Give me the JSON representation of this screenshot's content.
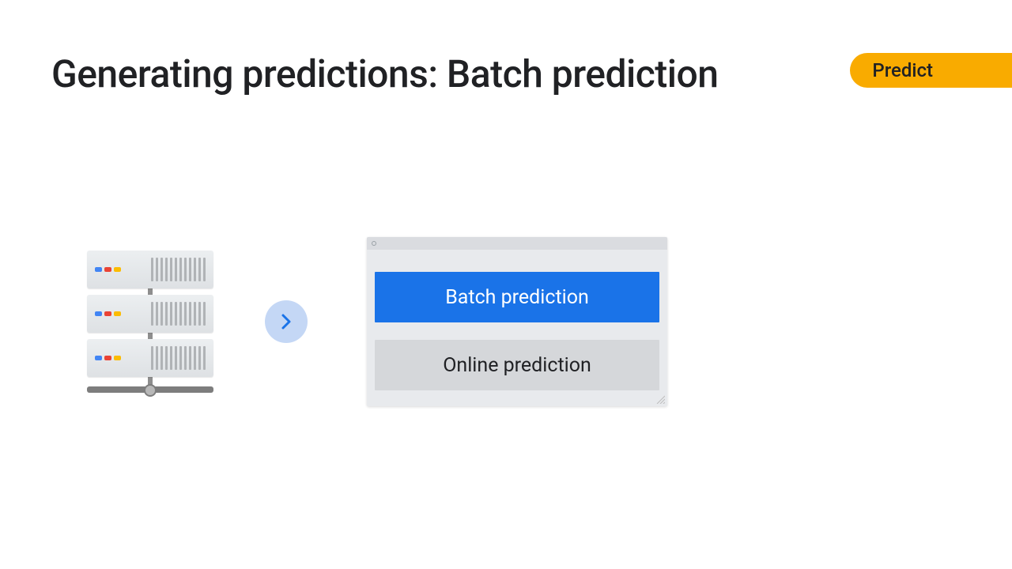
{
  "title": "Generating predictions: Batch prediction",
  "badge": "Predict",
  "options": {
    "primary": "Batch prediction",
    "secondary": "Online prediction"
  },
  "colors": {
    "accent": "#f9ab00",
    "primary_button": "#1a73e8",
    "secondary_button": "#d5d7da",
    "arrow_bg": "#c4d7f5",
    "arrow_fg": "#1a73e8"
  },
  "icons": {
    "server": "server-rack-icon",
    "arrow": "chevron-right-icon",
    "resize": "resize-handle-icon"
  }
}
